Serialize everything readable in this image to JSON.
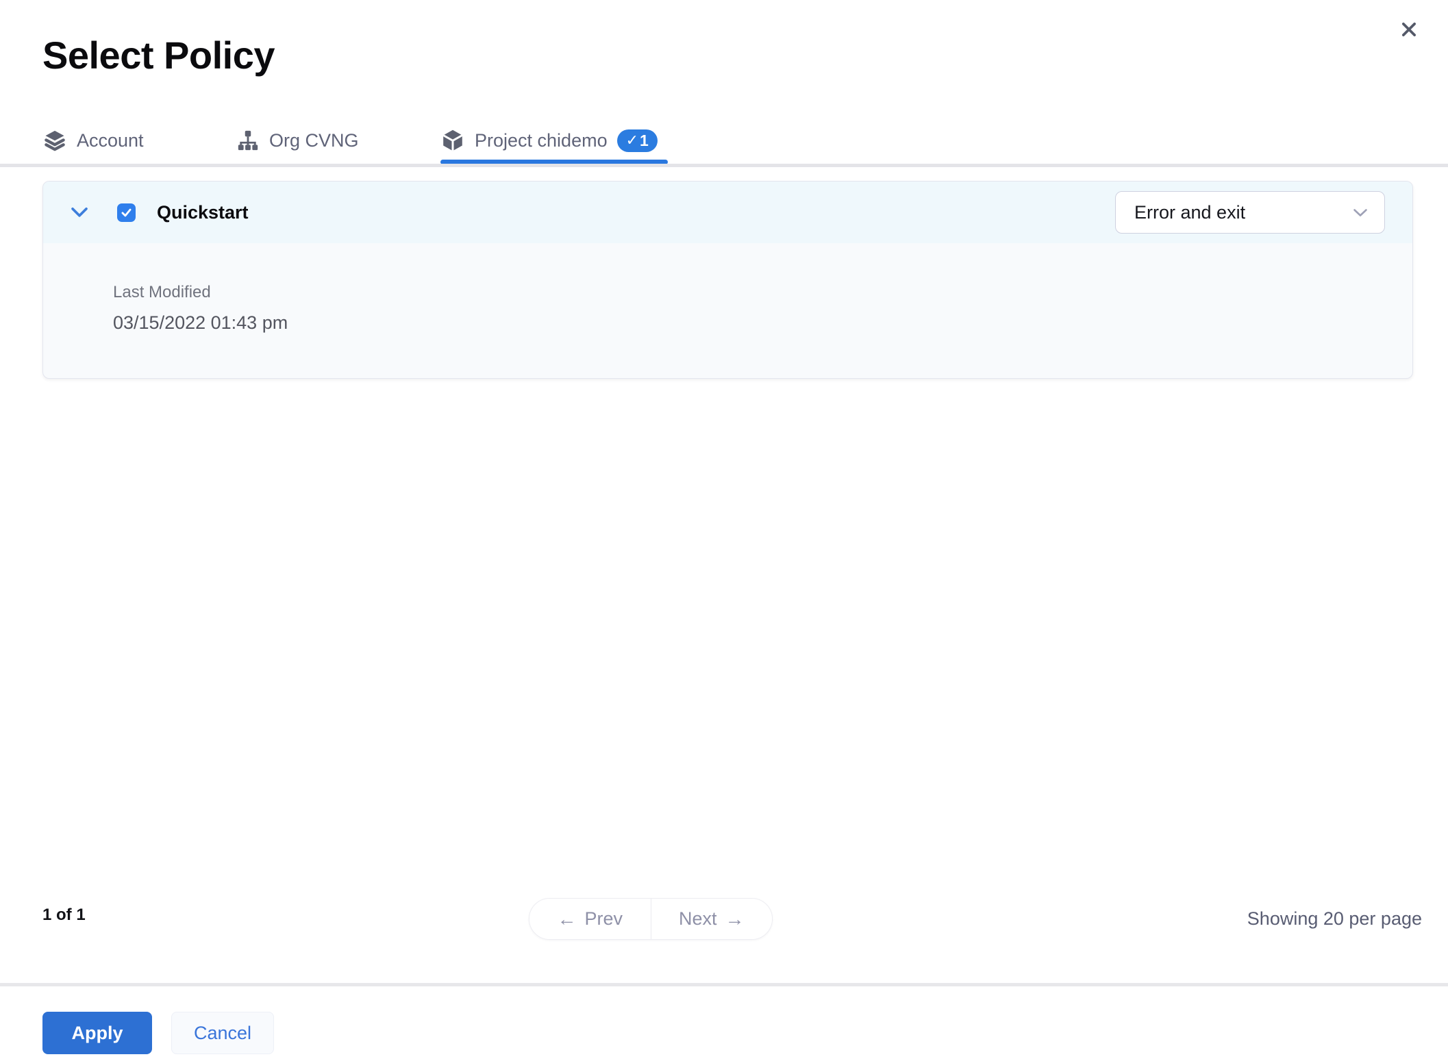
{
  "colors": {
    "accent_blue": "#2D70D3",
    "checkbox_blue": "#2F7FEC",
    "badge_blue": "#2B7CE0",
    "tab_underline_blue": "#2A78DF",
    "card_header_bg": "#EFF8FC",
    "card_body_bg": "#F8FAFC"
  },
  "modal": {
    "title": "Select Policy"
  },
  "tabs": [
    {
      "label": "Account",
      "icon": "layers-icon",
      "active": false
    },
    {
      "label": "Org CVNG",
      "icon": "hierarchy-icon",
      "active": false
    },
    {
      "label": "Project chidemo",
      "icon": "cube-icon",
      "active": true,
      "badge_check": "✓",
      "badge_count": "1"
    }
  ],
  "policies": [
    {
      "name": "Quickstart",
      "checked": true,
      "expanded": true,
      "action_value": "Error and exit",
      "last_modified_label": "Last Modified",
      "last_modified_value": "03/15/2022 01:43 pm"
    }
  ],
  "pagination": {
    "count_text": "1 of 1",
    "prev_arrow": "←",
    "prev_label": "Prev",
    "next_label": "Next",
    "next_arrow": "→",
    "per_page_text": "Showing 20 per page"
  },
  "footer": {
    "apply_label": "Apply",
    "cancel_label": "Cancel"
  }
}
